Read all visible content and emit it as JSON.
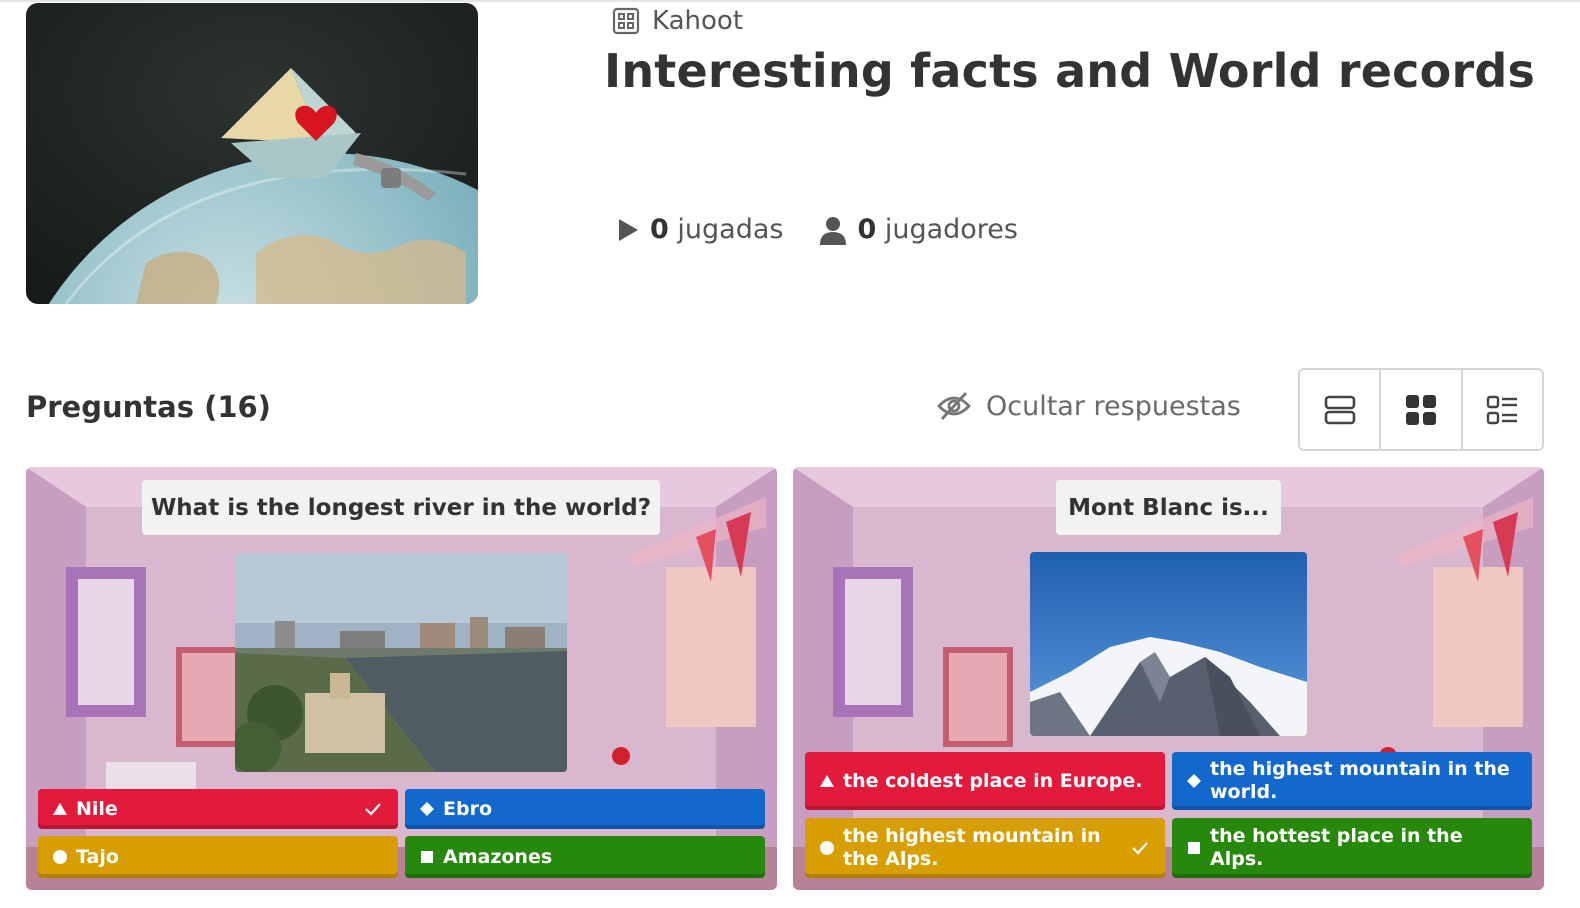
{
  "kahoot": {
    "type_label": "Kahoot",
    "title": "Interesting facts and World records",
    "plays_count": "0",
    "plays_label": "jugadas",
    "players_count": "0",
    "players_label": "jugadores"
  },
  "questions_section": {
    "header": "Preguntas (16)",
    "hide_answers_label": "Ocultar respuestas"
  },
  "cards": [
    {
      "question": "What is the longest river in the world?",
      "answers": [
        {
          "text": "Nile",
          "color": "#e21b3c",
          "shape": "triangle",
          "correct": true
        },
        {
          "text": "Ebro",
          "color": "#1368ce",
          "shape": "diamond",
          "correct": false
        },
        {
          "text": "Tajo",
          "color": "#d89e00",
          "shape": "circle",
          "correct": false
        },
        {
          "text": "Amazones",
          "color": "#26890c",
          "shape": "square",
          "correct": false
        }
      ]
    },
    {
      "question": "Mont Blanc is...",
      "answers": [
        {
          "text": "the coldest place in Europe.",
          "color": "#e21b3c",
          "shape": "triangle",
          "correct": false
        },
        {
          "text": "the highest mountain in the world.",
          "color": "#1368ce",
          "shape": "diamond",
          "correct": false
        },
        {
          "text": "the highest mountain in the Alps.",
          "color": "#d89e00",
          "shape": "circle",
          "correct": true
        },
        {
          "text": "the hottest place in the Alps.",
          "color": "#26890c",
          "shape": "square",
          "correct": false
        }
      ]
    }
  ],
  "icons": {
    "kahoot_type": "kahoot-grid-icon",
    "plays": "play-icon",
    "players": "user-icon",
    "hide": "eye-slash-icon",
    "view_list_large": "rows-view-icon",
    "view_grid": "grid-view-icon",
    "view_list_compact": "list-view-icon"
  }
}
